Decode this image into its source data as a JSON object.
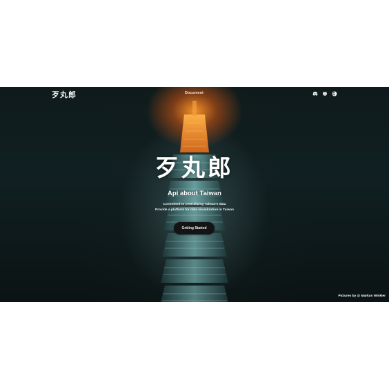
{
  "brand": {
    "logo_text": "歹丸郎"
  },
  "nav": {
    "document_label": "Document"
  },
  "toolbar": {
    "icons": [
      "discord-icon",
      "github-icon",
      "theme-toggle-icon"
    ]
  },
  "hero": {
    "title": "歹丸郎",
    "subtitle": "Api about Taiwan",
    "description_line1": "Committed to centralizing Taiwan's data",
    "description_line2": "Provide a platform for data visualization in Taiwan",
    "cta_label": "Getting Started"
  },
  "footer": {
    "credit_prefix": "Pictures by @",
    "credit_name": "Markus Winkler"
  },
  "colors": {
    "accent_glow": "#ff9628",
    "button_bg": "#141414",
    "background": "#0f1a1b"
  }
}
